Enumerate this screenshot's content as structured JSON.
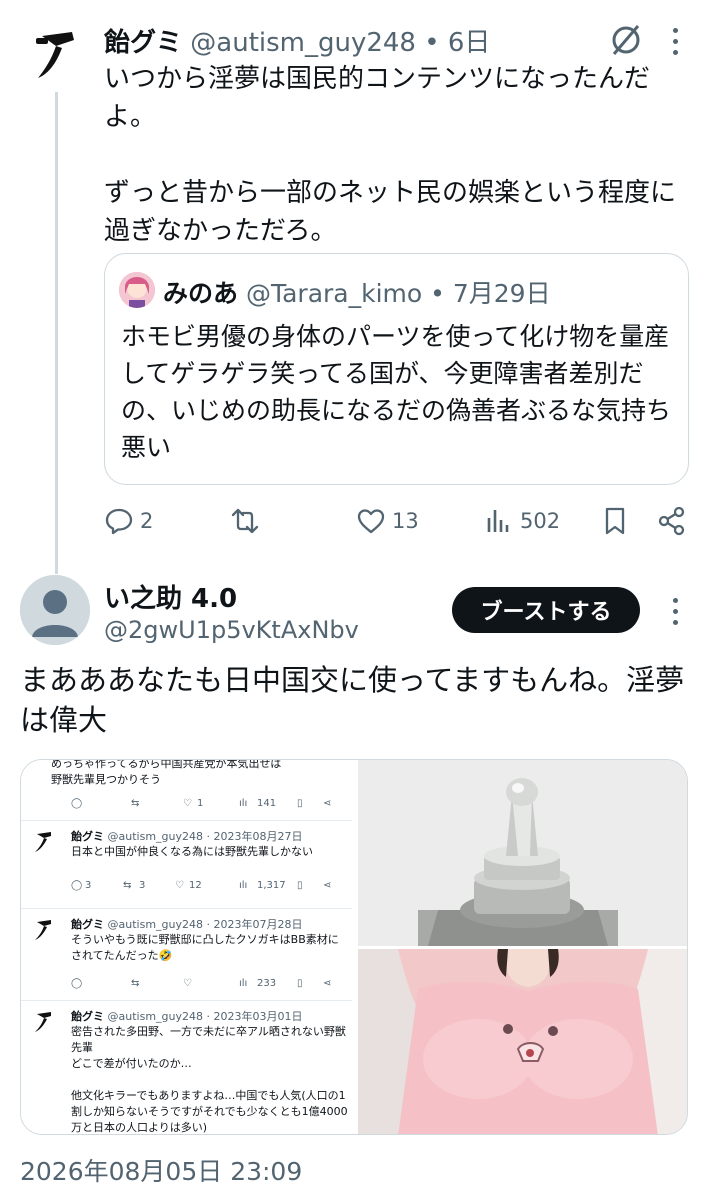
{
  "parent_tweet": {
    "name": "飴グミ",
    "handle": "@autism_guy248",
    "dot": "•",
    "age": "6日",
    "body": "いつから淫夢は国民的コンテンツになったんだよ。\n\nずっと昔から一部のネット民の娯楽という程度に過ぎなかっただろ。",
    "quote": {
      "name": "みのあ",
      "handle": "@Tarara_kimo",
      "dot": "•",
      "date": "7月29日",
      "body": "ホモビ男優の身体のパーツを使って化け物を量産してゲラゲラ笑ってる国が、今更障害者差別だの、いじめの助長になるだの偽善者ぶるな気持ち悪い"
    },
    "actions": {
      "replies": "2",
      "retweets": "",
      "likes": "13",
      "views": "502"
    }
  },
  "reply_tweet": {
    "name": "い之助 4.0",
    "handle": "@2gwU1p5vKtAxNbv",
    "boost_label": "ブーストする",
    "body": "まあああなたも日中国交に使ってますもんね。淫夢は偉大",
    "timestamp": "2026年08月05日 23:09"
  },
  "screenshot_media": {
    "top_fragment": "めっちゃ作ってるから中国共産党が本気出せば\n野獣先輩見つかりそう",
    "top_actions": {
      "replies": "",
      "retweets": "",
      "likes": "1",
      "views": "141"
    },
    "tweets": [
      {
        "name": "飴グミ",
        "meta": "@autism_guy248 · 2023年08月27日",
        "body": "日本と中国が仲良くなる為には野獣先輩しかない",
        "actions": {
          "replies": "3",
          "retweets": "3",
          "likes": "12",
          "views": "1,317"
        }
      },
      {
        "name": "飴グミ",
        "meta": "@autism_guy248 · 2023年07月28日",
        "body": "そういやもう既に野獣邸に凸したクソガキはBB素材にされてたんだった🤣",
        "actions": {
          "replies": "",
          "retweets": "",
          "likes": "",
          "views": "233"
        }
      },
      {
        "name": "飴グミ",
        "meta": "@autism_guy248 · 2023年03月01日",
        "body": "密告された多田野、一方で未だに卒アル晒されない野獣先輩\nどこで差が付いたのか…\n\n他文化キラーでもありますよね…中国でも人気(人口の1割しか知らないそうですがそれでも少なくとも1億4000万と日本の人口よりは多い)",
        "actions": null
      }
    ]
  },
  "colors": {
    "text": "#0f1419",
    "muted": "#536471",
    "border": "#cfd9de",
    "button_bg": "#0f1419",
    "button_text": "#ffffff"
  },
  "icons": [
    "reply-icon",
    "retweet-icon",
    "like-icon",
    "views-icon",
    "bookmark-icon",
    "share-icon",
    "grok-icon",
    "more-icon"
  ]
}
